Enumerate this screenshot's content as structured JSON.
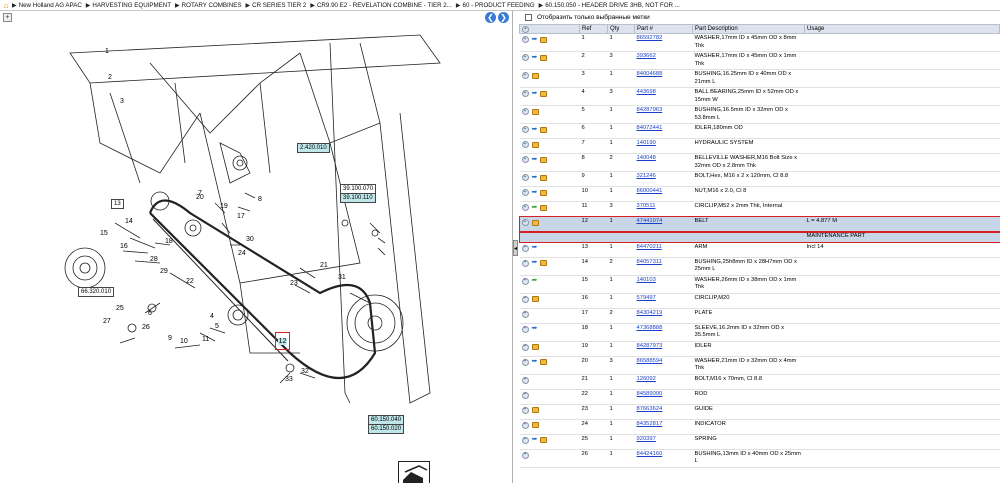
{
  "breadcrumb": [
    "New Holland AG APAC",
    "HARVESTING EQUIPMENT",
    "ROTARY COMBINES",
    "CR SERIES TIER 2",
    "CR9.90 E2 - REVELATION COMBINE - TIER 2...",
    "60 - PRODUCT FEEDING",
    "60.150.050 - HEADER DRIVE 3HB, NOT FOR ..."
  ],
  "filter_label": "Отобразить только выбранные метки",
  "columns": [
    "",
    "Ref",
    "Qty",
    "Part #",
    "Part Description",
    "Usage"
  ],
  "drawing_labels": {
    "a": "2.420.010",
    "b1": "39.100.070",
    "b2": "39.100.110",
    "c": "66.320.010",
    "d1": "60.150.040",
    "d2": "60.150.020",
    "sel": "12",
    "n13": "13"
  },
  "callouts": [
    "1",
    "2",
    "3",
    "4",
    "5",
    "6",
    "7",
    "8",
    "9",
    "10",
    "11",
    "14",
    "15",
    "16",
    "17",
    "18",
    "19",
    "20",
    "21",
    "22",
    "23",
    "24",
    "25",
    "26",
    "27",
    "28",
    "29",
    "30",
    "31",
    "32",
    "33"
  ],
  "rows": [
    {
      "ref": "1",
      "qty": "1",
      "part": "86592782",
      "desc": "WASHER,17mm ID x 45mm OD x 8mm Thk",
      "usage": "",
      "info": true,
      "arrow": false,
      "box": true
    },
    {
      "ref": "2",
      "qty": "3",
      "part": "393662",
      "desc": "WASHER,17mm ID x 45mm OD x 1mm Thk",
      "usage": "",
      "info": true,
      "arrow": false,
      "box": true
    },
    {
      "ref": "3",
      "qty": "1",
      "part": "84004688",
      "desc": "BUSHING,16.25mm ID x 40mm OD x 21mm L",
      "usage": "",
      "info": false,
      "arrow": false,
      "box": true
    },
    {
      "ref": "4",
      "qty": "3",
      "part": "443698",
      "desc": "BALL BEARING,25mm ID x 52mm OD x 15mm W",
      "usage": "",
      "info": true,
      "arrow": false,
      "box": true
    },
    {
      "ref": "5",
      "qty": "1",
      "part": "84287963",
      "desc": "BUSHING,16.5mm ID x 32mm OD x 53.8mm L",
      "usage": "",
      "info": false,
      "arrow": false,
      "box": true
    },
    {
      "ref": "6",
      "qty": "1",
      "part": "84072441",
      "desc": "IDLER,180mm OD",
      "usage": "",
      "info": true,
      "arrow": false,
      "box": true
    },
    {
      "ref": "7",
      "qty": "1",
      "part": "140190",
      "desc": "HYDRAULIC SYSTEM",
      "usage": "",
      "info": false,
      "arrow": false,
      "box": true
    },
    {
      "ref": "8",
      "qty": "2",
      "part": "140048",
      "desc": "BELLEVILLE WASHER,M16 Bolt Size x 32mm OD x 2.8mm Thk",
      "usage": "",
      "info": true,
      "arrow": false,
      "box": true
    },
    {
      "ref": "9",
      "qty": "1",
      "part": "321246",
      "desc": "BOLT,Hex, M16 x 2 x 120mm, Cl 8.8",
      "usage": "",
      "info": true,
      "arrow": false,
      "box": true
    },
    {
      "ref": "10",
      "qty": "1",
      "part": "86000441",
      "desc": "NUT,M16 x 2.0, Cl 8",
      "usage": "",
      "info": true,
      "arrow": false,
      "box": true
    },
    {
      "ref": "11",
      "qty": "3",
      "part": "370511",
      "desc": "CIRCLIP,M52 x 2mm Thk, Internal",
      "usage": "",
      "info": false,
      "arrow": true,
      "box": true
    },
    {
      "ref": "12",
      "qty": "1",
      "part": "47441074",
      "desc": "BELT",
      "usage": "L = 4.877 M",
      "info": false,
      "arrow": false,
      "box": true,
      "selected": true,
      "note": "MAINTENANCE PART"
    },
    {
      "ref": "13",
      "qty": "1",
      "part": "84470211",
      "desc": "ARM",
      "usage": "Incl 14",
      "info": true,
      "arrow": false,
      "box": false
    },
    {
      "ref": "14",
      "qty": "2",
      "part": "84057311",
      "desc": "BUSHING,25h8mm ID x 28H7mm OD x 25mm L",
      "usage": "",
      "info": true,
      "arrow": false,
      "box": true
    },
    {
      "ref": "15",
      "qty": "1",
      "part": "140103",
      "desc": "WASHER,26mm ID x 38mm OD x 1mm Thk",
      "usage": "",
      "info": false,
      "arrow": true,
      "box": false
    },
    {
      "ref": "16",
      "qty": "1",
      "part": "579497",
      "desc": "CIRCLIP,M20",
      "usage": "",
      "info": false,
      "arrow": false,
      "box": true
    },
    {
      "ref": "17",
      "qty": "2",
      "part": "84304219",
      "desc": "PLATE",
      "usage": "",
      "info": false,
      "arrow": false,
      "box": false
    },
    {
      "ref": "18",
      "qty": "1",
      "part": "47368888",
      "desc": "SLEEVE,16.2mm ID x 32mm OD x 35.5mm L",
      "usage": "",
      "info": true,
      "arrow": false,
      "box": false
    },
    {
      "ref": "19",
      "qty": "1",
      "part": "84287973",
      "desc": "IDLER",
      "usage": "",
      "info": false,
      "arrow": false,
      "box": true
    },
    {
      "ref": "20",
      "qty": "3",
      "part": "86588594",
      "desc": "WASHER,21mm ID x 32mm OD x 4mm Thk",
      "usage": "",
      "info": true,
      "arrow": false,
      "box": true
    },
    {
      "ref": "21",
      "qty": "1",
      "part": "126092",
      "desc": "BOLT,M16 x 70mm, Cl 8.8",
      "usage": "",
      "info": false,
      "arrow": false,
      "box": false
    },
    {
      "ref": "22",
      "qty": "1",
      "part": "84589000",
      "desc": "ROD",
      "usage": "",
      "info": false,
      "arrow": false,
      "box": false
    },
    {
      "ref": "23",
      "qty": "1",
      "part": "87663624",
      "desc": "GUIDE",
      "usage": "",
      "info": false,
      "arrow": false,
      "box": true
    },
    {
      "ref": "24",
      "qty": "1",
      "part": "84352817",
      "desc": "INDICATOR",
      "usage": "",
      "info": false,
      "arrow": false,
      "box": true
    },
    {
      "ref": "25",
      "qty": "1",
      "part": "920397",
      "desc": "SPRING",
      "usage": "",
      "info": true,
      "arrow": false,
      "box": true
    },
    {
      "ref": "26",
      "qty": "1",
      "part": "84424160",
      "desc": "BUSHING,13mm ID x 40mm OD x 25mm L",
      "usage": "",
      "info": false,
      "arrow": false,
      "box": false
    }
  ]
}
